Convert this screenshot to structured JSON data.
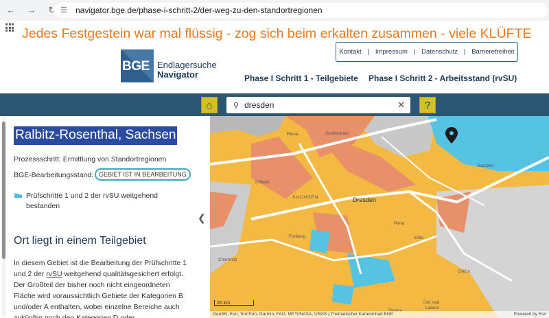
{
  "browser": {
    "url": "navigator.bge.de/phase-i-schritt-2/der-weg-zu-den-standortregionen"
  },
  "banner": "Jedes Festgestein war mal flüssig - zog sich beim erkalten zusammen - viele KLÜFTE",
  "header": {
    "logo_text": "BGE",
    "brand_line1": "Endlagersuche",
    "brand_line2": "Navigator",
    "links": [
      "Kontakt",
      "Impressum",
      "Datenschutz",
      "Barrierefreiheit"
    ],
    "phase1": "Phase I Schritt 1 - Teilgebiete",
    "phase2": "Phase I Schritt 2 - Arbeitsstand (rvSU)"
  },
  "search": {
    "value": "dresden"
  },
  "panel": {
    "title": "Ralbitz-Rosenthal, Sachsen",
    "prozess_label": "Prozessschritt: Ermittlung von Standortregionen",
    "stand_label": "BGE-Bearbeitungsstand:",
    "stand_badge": "GEBIET IST IN BEARBEITUNG",
    "legend_line1": "Prüfschritte 1 und 2 der rvSU weitgehend",
    "legend_line2": "bestanden",
    "heading": "Ort liegt in einem Teilgebiet",
    "body_pre": "In diesem Gebiet ist die Bearbeitung der Prüfschritte 1 und 2 der ",
    "body_link": "rvSU",
    "body_post": " weitgehend qualitätsgesichert erfolgt. Der Großteil der bisher noch nicht eingeordneten Fläche wird voraussichtlich Gebiete der Kategorien B und/oder A enthalten, wobei einzelne Bereiche auch zukünftig noch den Kategorien D oder"
  },
  "map": {
    "labels": {
      "riesa": "Riesa",
      "grossenhain": "Großenhain",
      "doebeln": "Döbeln",
      "sachsen": "SACHSEN",
      "dresden": "Dresden",
      "pirna": "Pirna",
      "freiberg": "Freiberg",
      "chemnitz": "Chemnitz",
      "decin": "Děčín",
      "bautzen": "Bautzen",
      "usti": "Ústí nad",
      "labem": "Labem",
      "teplice": "Teplice",
      "elbe": "Elbe"
    },
    "scale": "20 km",
    "attribution": "GeoSN, Esri, TomTom, Garmin, FAO, METI/NASA, USGS | Thematischer Karteninhalt BGE",
    "powered_by": "Powered by Esri",
    "colors": {
      "orange": "#f4b942",
      "salmon": "#e8906a",
      "cyan": "#57c3e3",
      "grey": "#c8c8c8",
      "road": "#ffffff"
    }
  }
}
